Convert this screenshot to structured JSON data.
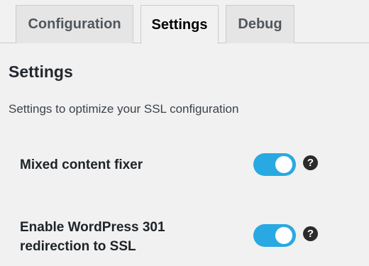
{
  "tabs": [
    {
      "label": "Configuration",
      "active": false
    },
    {
      "label": "Settings",
      "active": true
    },
    {
      "label": "Debug",
      "active": false
    }
  ],
  "section": {
    "title": "Settings",
    "description": "Settings to optimize your SSL configuration"
  },
  "settings": [
    {
      "label": "Mixed content fixer",
      "enabled": true,
      "help_icon": "question-circle-icon",
      "help_glyph": "?"
    },
    {
      "label": "Enable WordPress 301 redirection to SSL",
      "enabled": true,
      "help_icon": "question-circle-icon",
      "help_glyph": "?"
    }
  ],
  "colors": {
    "toggle_on": "#29a9e1",
    "background": "#f1f1f1",
    "tab_inactive": "#e5e5e5"
  }
}
